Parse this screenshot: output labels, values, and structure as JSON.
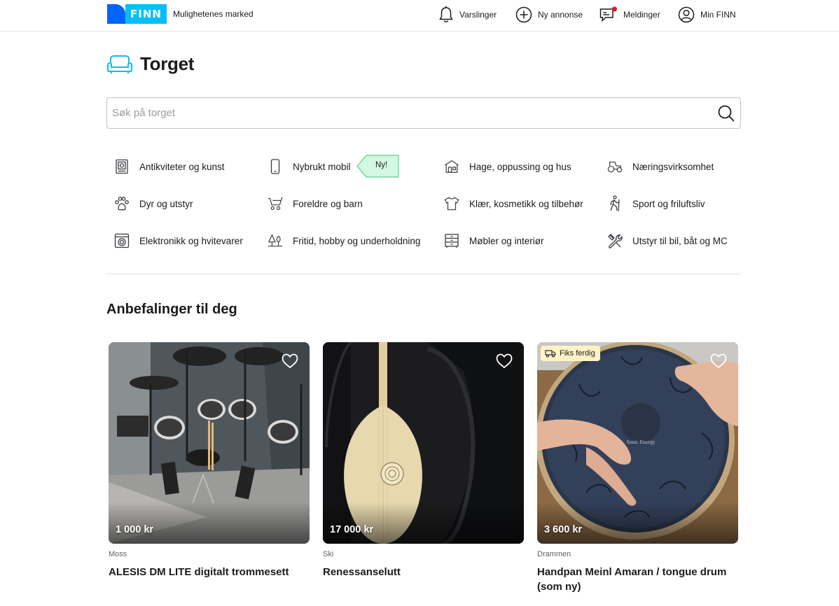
{
  "header": {
    "logo_text": "FINN",
    "tagline": "Mulighetenes marked",
    "nav": [
      {
        "label": "Varslinger",
        "icon": "bell-icon"
      },
      {
        "label": "Ny annonse",
        "icon": "plus-circle-icon"
      },
      {
        "label": "Meldinger",
        "icon": "chat-icon"
      },
      {
        "label": "Min FINN",
        "icon": "user-circle-icon"
      }
    ]
  },
  "page": {
    "title": "Torget",
    "title_icon": "sofa-icon"
  },
  "search": {
    "placeholder": "Søk på torget",
    "value": ""
  },
  "categories": [
    {
      "label": "Antikviteter og kunst",
      "icon": "frame-icon"
    },
    {
      "label": "Nybrukt mobil",
      "icon": "mobile-icon",
      "badge": "Ny!"
    },
    {
      "label": "Hage, oppussing og hus",
      "icon": "house-icon"
    },
    {
      "label": "Næringsvirksomhet",
      "icon": "tractor-icon"
    },
    {
      "label": "Dyr og utstyr",
      "icon": "paw-icon"
    },
    {
      "label": "Foreldre og barn",
      "icon": "stroller-icon"
    },
    {
      "label": "Klær, kosmetikk og tilbehør",
      "icon": "shirt-icon"
    },
    {
      "label": "Sport og friluftsliv",
      "icon": "hiker-icon"
    },
    {
      "label": "Elektronikk og hvitevarer",
      "icon": "washer-icon"
    },
    {
      "label": "Fritid, hobby og underholdning",
      "icon": "trees-icon"
    },
    {
      "label": "Møbler og interiør",
      "icon": "dresser-icon"
    },
    {
      "label": "Utstyr til bil, båt og MC",
      "icon": "tools-icon"
    }
  ],
  "recommendations": {
    "heading": "Anbefalinger til deg",
    "items": [
      {
        "price": "1 000 kr",
        "location": "Moss",
        "title": "ALESIS DM LITE digitalt trommesett",
        "image": "electronic drum kit"
      },
      {
        "price": "17 000 kr",
        "location": "Ski",
        "title": "Renessanselutt",
        "image": "lute in case"
      },
      {
        "price": "3 600 kr",
        "location": "Drammen",
        "title": "Handpan Meinl Amaran / tongue drum (som ny)",
        "image": "handpan drum",
        "tag": "Fiks ferdig"
      }
    ]
  },
  "colors": {
    "brand_dark": "#0063fb",
    "brand_light": "#06befb",
    "badge_green": "#d3f7e0",
    "badge_border": "#5ad28c",
    "notification_dot": "#e2122a",
    "fiks_bg": "#fef3c5"
  }
}
